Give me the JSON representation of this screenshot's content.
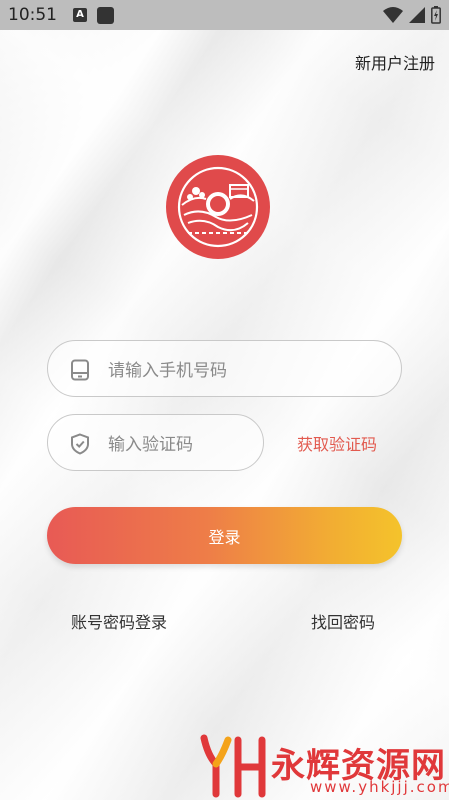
{
  "status_bar": {
    "time": "10:51",
    "notification_icon": "A"
  },
  "header": {
    "register_label": "新用户注册"
  },
  "form": {
    "phone_placeholder": "请输入手机号码",
    "code_placeholder": "输入验证码",
    "get_code_label": "获取验证码",
    "login_label": "登录"
  },
  "links": {
    "account_login": "账号密码登录",
    "forgot_password": "找回密码"
  },
  "watermark": {
    "title": "永辉资源网",
    "url": "www.yhkjjj.com"
  },
  "colors": {
    "accent": "#e25a4f",
    "gradient_start": "#e85a55",
    "gradient_end": "#f4c32b",
    "logo_red": "#e04a4b"
  },
  "icons": {
    "phone": "tablet-icon",
    "code": "shield-check-icon"
  }
}
